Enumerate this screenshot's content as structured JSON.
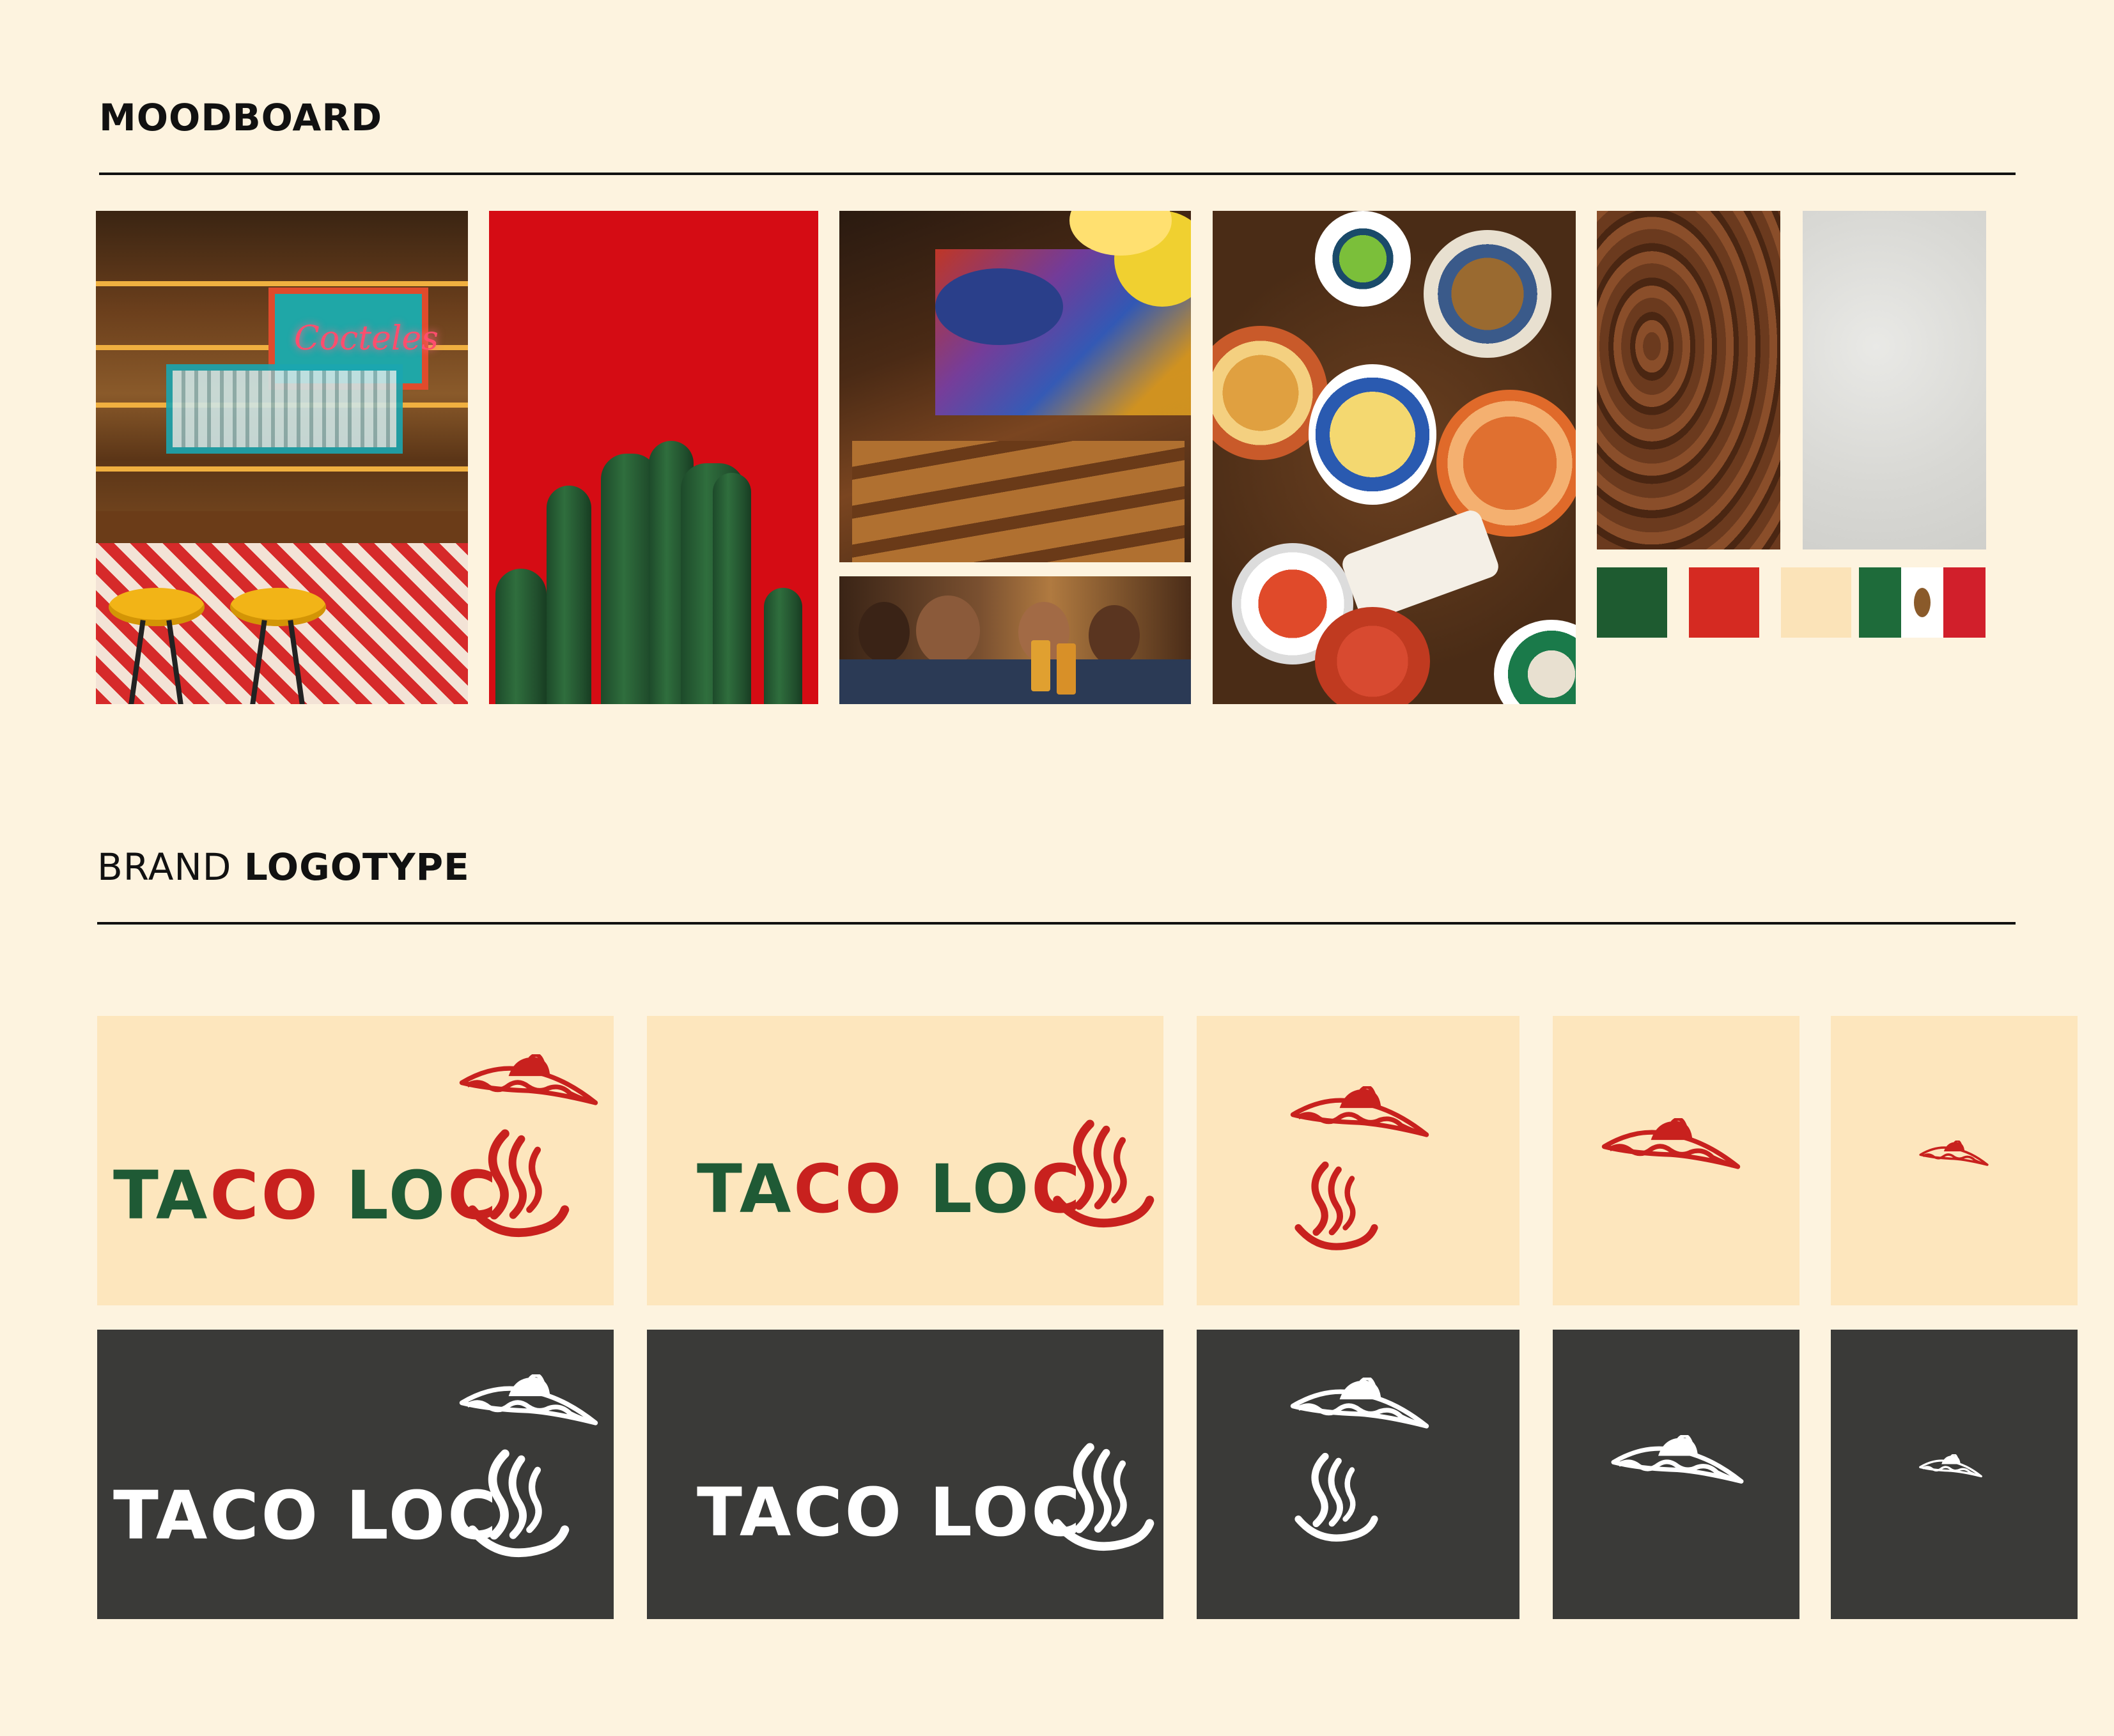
{
  "sections": {
    "moodboard": {
      "title": "MOODBOARD"
    },
    "brand_logotype": {
      "title_part1": "BRAND ",
      "title_part2": "LOGOTYPE"
    }
  },
  "moodboard": {
    "bar_sign_text": "Cocteles",
    "palette": {
      "green": "#1e5b30",
      "red": "#d52a22",
      "cream": "#fbe3b8",
      "flag": [
        "#1e6b3a",
        "#ffffff",
        "#d11f2b"
      ]
    }
  },
  "logotype": {
    "word1_part1": "TA",
    "word1_part2": "CO",
    "word2_part1": "LO",
    "word2_part2": "C",
    "colors": {
      "green": "#1f5a35",
      "red": "#c8211e",
      "light_bg": "#fde6bd",
      "dark_bg": "#3a3a38",
      "white": "#ffffff"
    }
  }
}
